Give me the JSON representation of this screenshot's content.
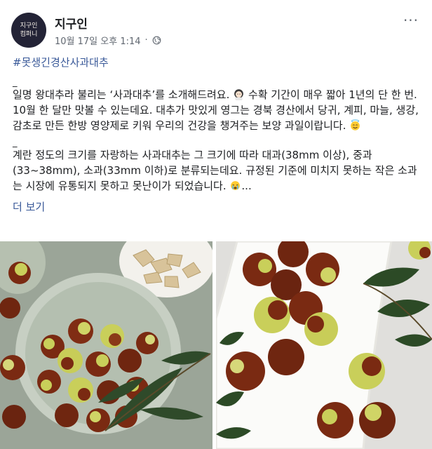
{
  "post": {
    "author": "지구인",
    "avatar_text": [
      "지구인",
      "컴퍼니"
    ],
    "timestamp": "10월 17일 오후 1:14",
    "visibility_icon": "globe-icon",
    "menu_icon": "more-icon",
    "hashtag": "#못생긴경산사과대추",
    "divider_mark": "_",
    "paragraph1_a": "일명 왕대추라 불리는 ‘사과대추’를 소개해드려요.",
    "paragraph1_b": " 수확 기간이 매우 짧아 1년의 단 한 번. 10월 한 달만 맛볼 수 있는데요. 대추가 맛있게 영그는 경북 경산에서 당귀, 계피, 마늘, 생강, 감초로 만든 한방 영양제로 키워 우리의 건강을 챙겨주는 보양 과일이랍니다.",
    "paragraph2": "계란 정도의 크기를 자랑하는 사과대추는 그 크기에 따라 대과(38mm 이상), 중과(33~38mm), 소과(33mm 이하)로 분류되는데요. 규정된 기준에 미치지 못하는 작은 소과는 시장에 유통되지 못하고 못난이가 되었습니다.",
    "ellipsis": "...",
    "see_more": "더 보기",
    "emojis": [
      "woman-emoji",
      "smiling-halo-emoji",
      "crying-emoji"
    ]
  },
  "colors": {
    "link": "#385898",
    "text": "#1c1e21",
    "meta": "#606770",
    "jujube_red": "#7a2a12",
    "jujube_green": "#c9cf5a"
  }
}
